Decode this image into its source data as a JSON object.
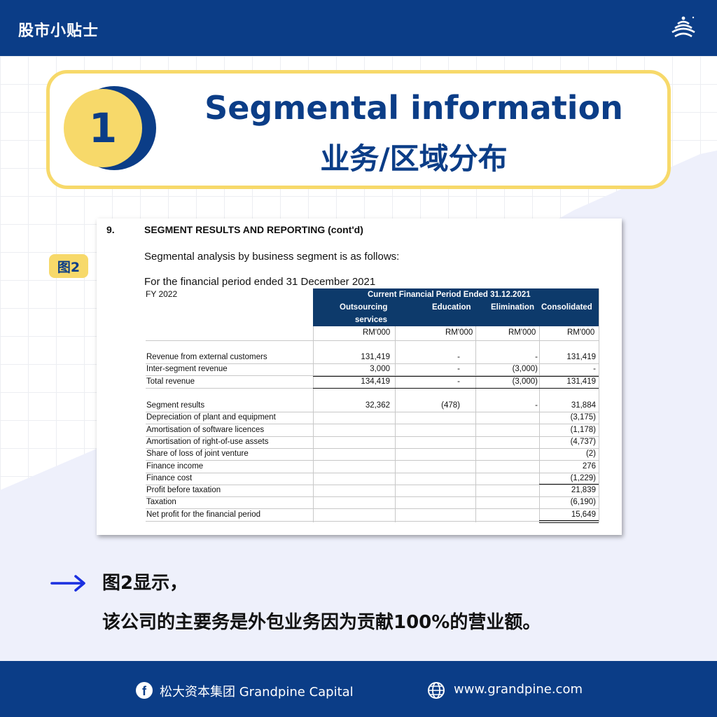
{
  "header": {
    "title": "股市小贴士",
    "logo_icon": "pine-tree-icon"
  },
  "hero": {
    "number": "1",
    "title_en": "Segmental information",
    "title_cn": "业务/区域分布"
  },
  "figure_label": "图2",
  "document": {
    "section_number": "9.",
    "heading": "SEGMENT RESULTS AND REPORTING (cont'd)",
    "intro": "Segmental analysis by business segment is as follows:",
    "period_line": "For the financial period ended 31 December 2021",
    "fy": "FY 2022",
    "table_title": "Current Financial Period Ended 31.12.2021",
    "columns": [
      {
        "line1": "Outsourcing",
        "line2": "services",
        "unit": "RM'000"
      },
      {
        "line1": "Education",
        "line2": "",
        "unit": "RM'000"
      },
      {
        "line1": "Elimination",
        "line2": "",
        "unit": "RM'000"
      },
      {
        "line1": "Consolidated",
        "line2": "",
        "unit": "RM'000"
      }
    ],
    "rows_revenue": [
      {
        "label": "Revenue from external customers",
        "values": [
          "131,419",
          "-",
          "-",
          "131,419"
        ]
      },
      {
        "label": "Inter-segment revenue",
        "values": [
          "3,000",
          "-",
          "(3,000)",
          "-"
        ]
      },
      {
        "label": "Total revenue",
        "values": [
          "134,419",
          "-",
          "(3,000)",
          "131,419"
        ]
      }
    ],
    "rows_results": [
      {
        "label": "Segment results",
        "values": [
          "32,362",
          "(478)",
          "-",
          "31,884"
        ]
      },
      {
        "label": "Depreciation of plant and equipment",
        "values": [
          "",
          "",
          "",
          "(3,175)"
        ]
      },
      {
        "label": "Amortisation of software licences",
        "values": [
          "",
          "",
          "",
          "(1,178)"
        ]
      },
      {
        "label": "Amortisation of right-of-use assets",
        "values": [
          "",
          "",
          "",
          "(4,737)"
        ]
      },
      {
        "label": "Share of loss of joint venture",
        "values": [
          "",
          "",
          "",
          "(2)"
        ]
      },
      {
        "label": "Finance income",
        "values": [
          "",
          "",
          "",
          "276"
        ]
      },
      {
        "label": "Finance cost",
        "values": [
          "",
          "",
          "",
          "(1,229)"
        ]
      },
      {
        "label": "Profit before taxation",
        "values": [
          "",
          "",
          "",
          "21,839"
        ]
      },
      {
        "label": "Taxation",
        "values": [
          "",
          "",
          "",
          "(6,190)"
        ]
      },
      {
        "label": "Net profit for the financial period",
        "values": [
          "",
          "",
          "",
          "15,649"
        ]
      }
    ]
  },
  "note": {
    "line1": "图2显示，",
    "line2": "该公司的主要务是外包业务因为贡献100%的营业额。",
    "arrow_icon": "arrow-right-icon"
  },
  "footer": {
    "facebook_icon": "facebook-icon",
    "facebook_text": "松大资本集团 Grandpine Capital",
    "web_icon": "globe-icon",
    "website": "www.grandpine.com"
  },
  "colors": {
    "brand_blue": "#0b3d87",
    "accent_yellow": "#f7d96a",
    "table_header": "#0d3a6b",
    "note_arrow": "#1a2fe0"
  }
}
